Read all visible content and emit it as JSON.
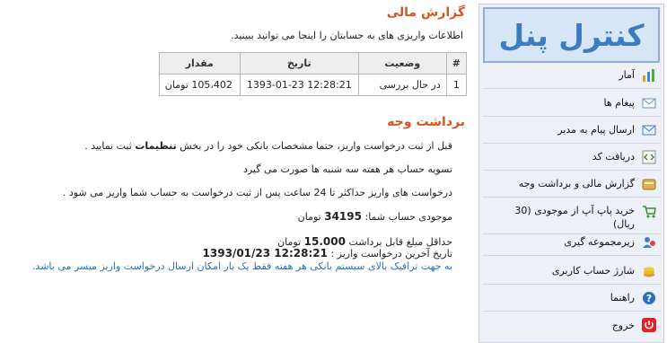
{
  "sidebar": {
    "logo_text": "کنترل پنل",
    "items": [
      {
        "label": "آمار",
        "icon": "bar-chart-icon"
      },
      {
        "label": "پیغام ها",
        "icon": "envelope-icon"
      },
      {
        "label": "ارسال پیام به مدیر",
        "icon": "send-mail-icon"
      },
      {
        "label": "دریافت کد",
        "icon": "code-icon"
      },
      {
        "label": "گزارش مالی و برداشت وجه",
        "icon": "wallet-icon"
      },
      {
        "label": "خرید پاپ آپ از موجودی (30 ریال)",
        "icon": "cart-icon"
      },
      {
        "label": "زیرمجموعه گیری",
        "icon": "users-icon"
      },
      {
        "label": "شارژ حساب کاربری",
        "icon": "coins-icon"
      },
      {
        "label": "راهنما",
        "icon": "help-icon"
      },
      {
        "label": "خروج",
        "icon": "power-icon"
      }
    ]
  },
  "report": {
    "title": "گزارش مالی",
    "intro": "اطلاعات واریزی های به حسابتان را اینجا می توانید ببینید.",
    "table": {
      "headers": [
        "#",
        "وضعیت",
        "تاریخ",
        "مقدار"
      ],
      "rows": [
        [
          "1",
          "در حال بررسی",
          "1393-01-23 12:28:21",
          "105،402 تومان"
        ]
      ]
    }
  },
  "withdraw": {
    "title": "برداشت وجه",
    "line1_before": "قبل از ثبت درخواست واریز، حتما مشخصات بانکی خود را در بخش",
    "line1_link": "تنظیمات",
    "line1_after": "ثبت نمایید .",
    "line2": "تسویه حساب هر هفته سه شنبه ها صورت می گیرد",
    "line3": "درخواست های واریز حداکثر تا 24 ساعت پس از ثبت درخواست به حساب شما واریز می شود .",
    "balance_label": "موجودی حساب شما:",
    "balance_value": "34195",
    "balance_unit": "تومان",
    "min_label": "حداقل مبلغ قابل برداشت",
    "min_value": "15.000",
    "min_unit": "تومان",
    "last_label": "تاریخ آخرین درخواست واریز :",
    "last_value": "1393/01/23 12:28:21",
    "notice": "به جهت ترافیک بالای سیستم بانکی هر هفته فقط یک بار امکان ارسال درخواست واریز میسر می باشد."
  }
}
